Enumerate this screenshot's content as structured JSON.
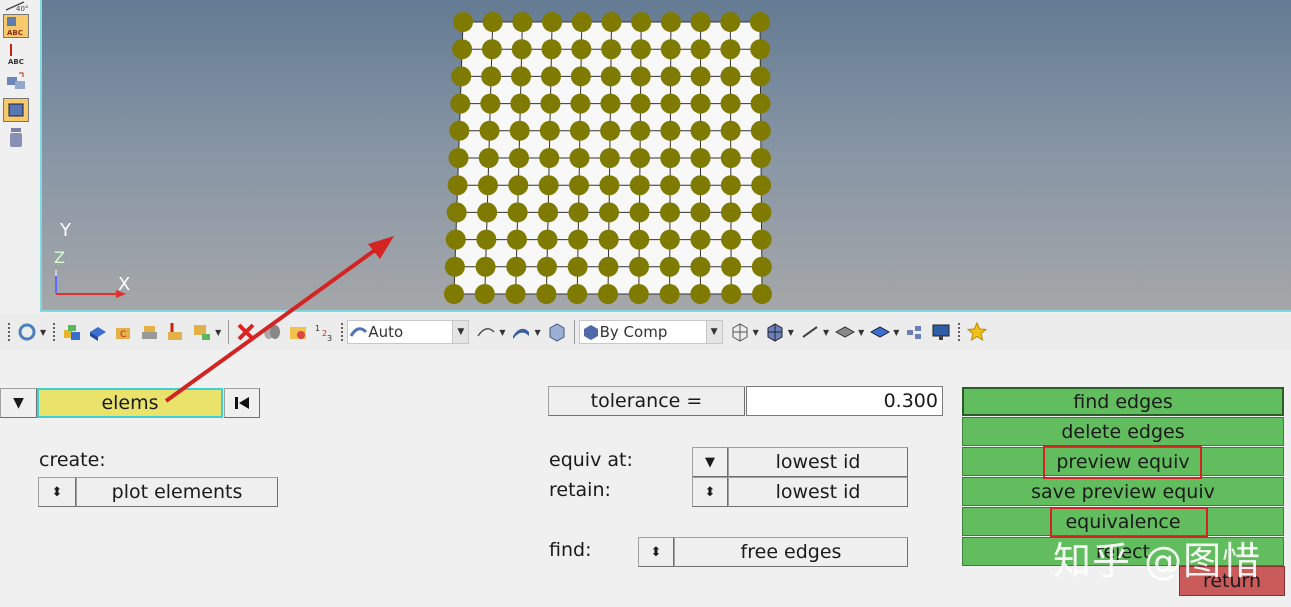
{
  "viewport": {
    "triad": {
      "y": "Y",
      "z": "Z",
      "x": "X"
    },
    "mesh": {
      "node_color": "#7f7a00",
      "background": "#f8f8f8"
    }
  },
  "toolbar": {
    "auto_combo": "Auto",
    "bycomp_combo": "By Comp"
  },
  "panel": {
    "entity_selector": "elems",
    "create_label": "create:",
    "plot_elements": "plot elements",
    "tolerance_label": "tolerance =",
    "tolerance_value": "0.300",
    "equiv_at_label": "equiv at:",
    "equiv_at_value": "lowest id",
    "retain_label": "retain:",
    "retain_value": "lowest id",
    "find_label": "find:",
    "find_value": "free edges",
    "buttons": {
      "find_edges": "find edges",
      "delete_edges": "delete edges",
      "preview_equiv": "preview equiv",
      "save_preview_equiv": "save preview equiv",
      "equivalence": "equivalence",
      "reject": "reject",
      "return": "return"
    }
  },
  "colors": {
    "accent_green": "#62bd5f",
    "return_red": "#c95b5b",
    "selector_yellow": "#e9e26b",
    "annotation_red": "#d42323"
  },
  "watermark": "知乎 @图惜"
}
